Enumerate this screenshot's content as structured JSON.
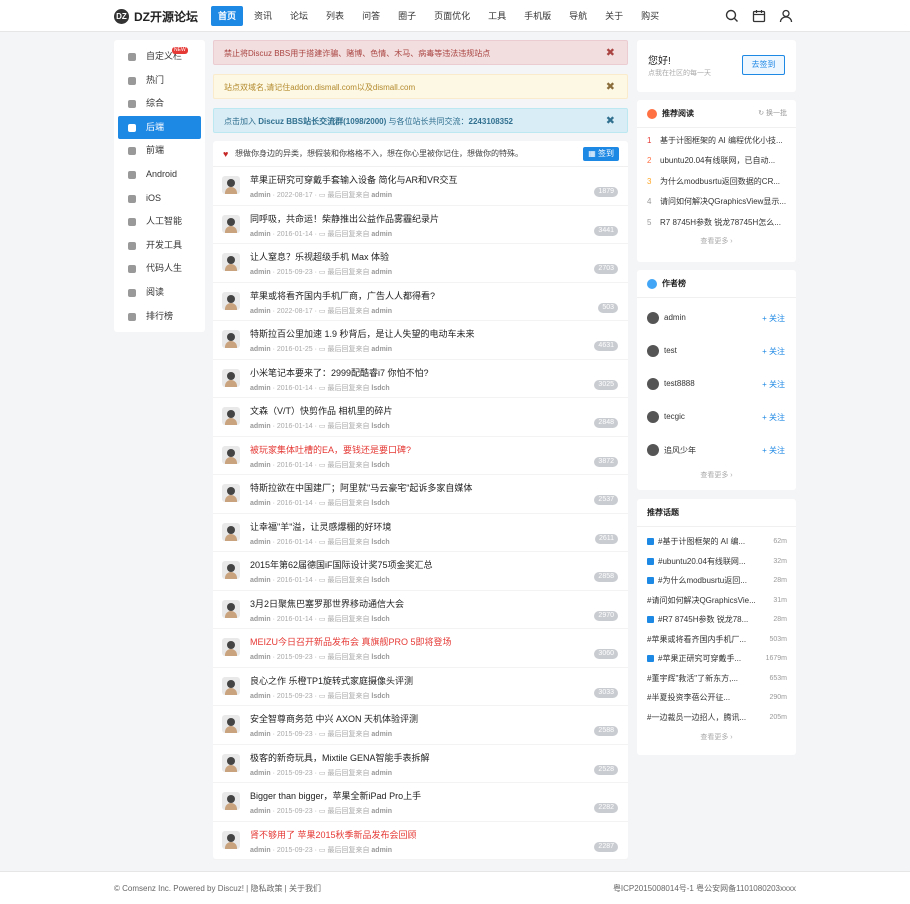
{
  "brand": {
    "name": "DZ开源论坛",
    "logo_glyph": "DZ"
  },
  "nav": [
    "首页",
    "资讯",
    "论坛",
    "列表",
    "问答",
    "圈子",
    "页面优化",
    "工具",
    "手机版",
    "导航",
    "关于",
    "购买"
  ],
  "header_icons": [
    "search-icon",
    "calendar-icon",
    "user-icon"
  ],
  "sidebar": {
    "new_badge": "NEW",
    "items": [
      {
        "label": "自定义栏",
        "icon": "cube-icon"
      },
      {
        "label": "热门",
        "icon": "document-icon"
      },
      {
        "label": "综合",
        "icon": "compass-icon"
      },
      {
        "label": "后端",
        "icon": "terminal-icon"
      },
      {
        "label": "前端",
        "icon": "monitor-icon"
      },
      {
        "label": "Android",
        "icon": "android-icon"
      },
      {
        "label": "iOS",
        "icon": "apple-icon"
      },
      {
        "label": "人工智能",
        "icon": "robot-icon"
      },
      {
        "label": "开发工具",
        "icon": "tools-icon"
      },
      {
        "label": "代码人生",
        "icon": "code-icon"
      },
      {
        "label": "阅读",
        "icon": "book-icon"
      },
      {
        "label": "排行榜",
        "icon": "trophy-icon"
      }
    ]
  },
  "alerts": [
    {
      "text": "禁止将Discuz BBS用于搭建诈骗、赌博、色情、木马、病毒等违法违规站点",
      "close": "✖"
    },
    {
      "text": "站点双域名,请记住addon.dismall.com以及dismall.com",
      "close": "✖"
    },
    {
      "text_pre": "点击加入 ",
      "text_bold": "Discuz BBS站长交流群(1098/2000)",
      "text_mid": " 与各位站长共同交流：",
      "text_bold2": "2243108352",
      "close": "✖"
    }
  ],
  "motto": "想做你身边的异类，想假装和你格格不入，想在你心里被你记住，想做你的特殊。",
  "sign_button": "签到",
  "threads": [
    {
      "title": "苹果正研究可穿戴手套输入设备 简化与AR和VR交互",
      "user": "admin",
      "date": "2022-08-17",
      "last": "最后回复来自",
      "last_user": "admin",
      "count": "1879",
      "red": false
    },
    {
      "title": "同呼吸，共命运！柴静推出公益作品雾霾纪录片",
      "user": "admin",
      "date": "2016-01-14",
      "last": "最后回复来自",
      "last_user": "admin",
      "count": "3441",
      "red": false
    },
    {
      "title": "让人窒息？乐视超级手机 Max 体验",
      "user": "admin",
      "date": "2015-09-23",
      "last": "最后回复来自",
      "last_user": "admin",
      "count": "2703",
      "red": false
    },
    {
      "title": "苹果或将看齐国内手机厂商，广告人人都得看?",
      "user": "admin",
      "date": "2022-08-17",
      "last": "最后回复来自",
      "last_user": "admin",
      "count": "503",
      "red": false
    },
    {
      "title": "特斯拉百公里加速 1.9 秒背后，是让人失望的电动车未来",
      "user": "admin",
      "date": "2016-01-25",
      "last": "最后回复来自",
      "last_user": "admin",
      "count": "4631",
      "red": false
    },
    {
      "title": "小米笔记本要来了：2999配酷睿i7 你怕不怕?",
      "user": "admin",
      "date": "2016-01-14",
      "last": "最后回复来自",
      "last_user": "lsdch",
      "count": "3025",
      "red": false
    },
    {
      "title": "文森（V/T）快剪作品 相机里的碎片",
      "user": "admin",
      "date": "2016-01-14",
      "last": "最后回复来自",
      "last_user": "lsdch",
      "count": "2848",
      "red": false
    },
    {
      "title": "被玩家集体吐槽的EA，要钱还是要口碑?",
      "user": "admin",
      "date": "2016-01-14",
      "last": "最后回复来自",
      "last_user": "lsdch",
      "count": "3872",
      "red": true
    },
    {
      "title": "特斯拉欲在中国建厂；阿里就\"马云豪宅\"起诉多家自媒体",
      "user": "admin",
      "date": "2016-01-14",
      "last": "最后回复来自",
      "last_user": "lsdch",
      "count": "2537",
      "red": false
    },
    {
      "title": "让幸福\"羊\"溢，让灵感爆棚的好环境",
      "user": "admin",
      "date": "2016-01-14",
      "last": "最后回复来自",
      "last_user": "lsdch",
      "count": "2611",
      "red": false
    },
    {
      "title": "2015年第62届德国iF国际设计奖75项金奖汇总",
      "user": "admin",
      "date": "2016-01-14",
      "last": "最后回复来自",
      "last_user": "lsdch",
      "count": "2858",
      "red": false
    },
    {
      "title": "3月2日聚焦巴塞罗那世界移动通信大会",
      "user": "admin",
      "date": "2016-01-14",
      "last": "最后回复来自",
      "last_user": "lsdch",
      "count": "2970",
      "red": false
    },
    {
      "title": "MEIZU今日召开新品发布会 真旗舰PRO 5即将登场",
      "user": "admin",
      "date": "2015-09-23",
      "last": "最后回复来自",
      "last_user": "lsdch",
      "count": "3060",
      "red": true
    },
    {
      "title": "良心之作 乐橙TP1旋转式家庭摄像头评测",
      "user": "admin",
      "date": "2015-09-23",
      "last": "最后回复来自",
      "last_user": "lsdch",
      "count": "3033",
      "red": false
    },
    {
      "title": "安全智尊商务范 中兴 AXON 天机体验评测",
      "user": "admin",
      "date": "2015-09-23",
      "last": "最后回复来自",
      "last_user": "admin",
      "count": "2588",
      "red": false
    },
    {
      "title": "极客的新奇玩具，Mixtile GENA智能手表拆解",
      "user": "admin",
      "date": "2015-09-23",
      "last": "最后回复来自",
      "last_user": "admin",
      "count": "2528",
      "red": false
    },
    {
      "title": "Bigger than bigger，苹果全新iPad Pro上手",
      "user": "admin",
      "date": "2015-09-23",
      "last": "最后回复来自",
      "last_user": "admin",
      "count": "2282",
      "red": false
    },
    {
      "title": "肾不够用了 苹果2015秋季新品发布会回顾",
      "user": "admin",
      "date": "2015-09-23",
      "last": "最后回复来自",
      "last_user": "admin",
      "count": "2287",
      "red": true
    }
  ],
  "greet": {
    "hello": "您好!",
    "sub": "点我在社区的每一天",
    "button": "去签到"
  },
  "recommend": {
    "title": "推荐阅读",
    "refresh": "换一批",
    "more": "查看更多 ›",
    "items": [
      {
        "n": "1",
        "text": "基于计图框架的 AI 编程优化小技..."
      },
      {
        "n": "2",
        "text": "ubuntu20.04有线联网，已自动..."
      },
      {
        "n": "3",
        "text": "为什么modbusrtu返回数据的CR..."
      },
      {
        "n": "4",
        "text": "请问如何解决QGraphicsView显示..."
      },
      {
        "n": "5",
        "text": "R7 8745H参数 锐龙78745H怎么..."
      }
    ]
  },
  "authors": {
    "title": "作者榜",
    "more": "查看更多 ›",
    "follow": "+ 关注",
    "items": [
      "admin",
      "test",
      "test8888",
      "tecgic",
      "追风少年"
    ]
  },
  "topics": {
    "title": "推荐话题",
    "more": "查看更多 ›",
    "items": [
      {
        "text": "#基于计图框架的 AI 编...",
        "count": "62m",
        "icon": true
      },
      {
        "text": "#ubuntu20.04有线联网...",
        "count": "32m",
        "icon": true
      },
      {
        "text": "#为什么modbusrtu返回...",
        "count": "28m",
        "icon": true
      },
      {
        "text": "#请问如何解决QGraphicsVie...",
        "count": "31m",
        "icon": false
      },
      {
        "text": "#R7 8745H参数 锐龙78...",
        "count": "28m",
        "icon": true
      },
      {
        "text": "#苹果或将看齐国内手机厂...",
        "count": "503m",
        "icon": false
      },
      {
        "text": "#苹果正研究可穿戴手...",
        "count": "1679m",
        "icon": true
      },
      {
        "text": "#董宇辉\"救活\"了新东方,...",
        "count": "653m",
        "icon": false
      },
      {
        "text": "#半夏投资李蓓公开征...",
        "count": "290m",
        "icon": false
      },
      {
        "text": "#一边裁员一边招人，腾讯...",
        "count": "205m",
        "icon": false
      }
    ]
  },
  "footer": {
    "left": "© Comsenz Inc. Powered by Discuz!  |  隐私政策  |  关于我们",
    "right": "粤ICP2015008014号-1     粤公安网备1101080203xxxx"
  },
  "colors": {
    "accent": "#1e88e5",
    "danger": "#e53935"
  }
}
